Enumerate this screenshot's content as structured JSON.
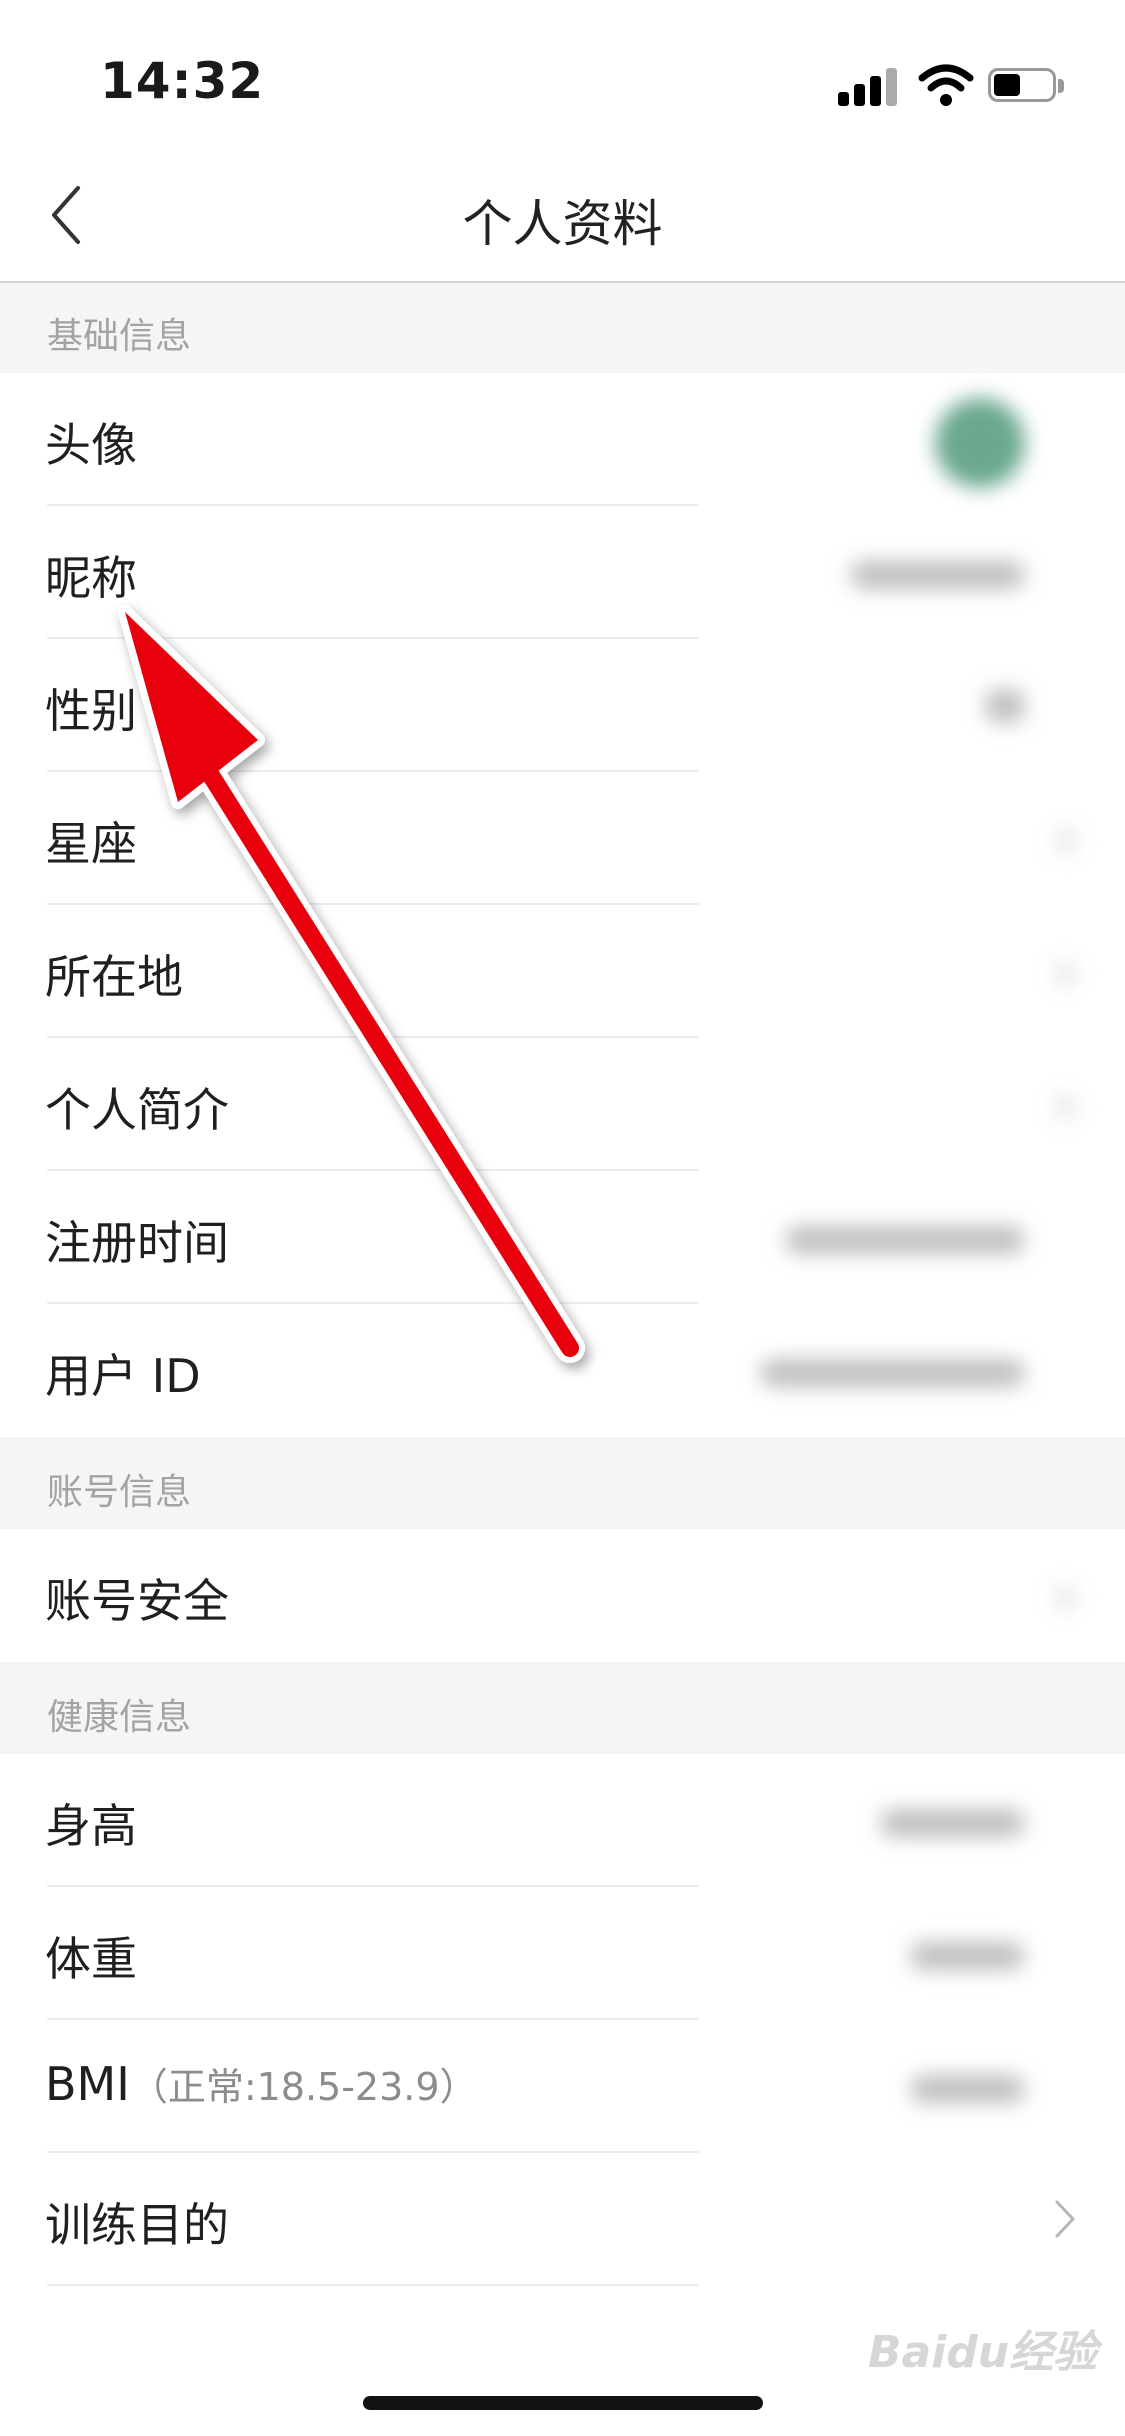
{
  "status_bar": {
    "time": "14:32"
  },
  "nav": {
    "title": "个人资料"
  },
  "sections": {
    "basic": "基础信息",
    "account": "账号信息",
    "health": "健康信息"
  },
  "rows": {
    "avatar": "头像",
    "nickname": "昵称",
    "gender": "性别",
    "constellation": "星座",
    "location": "所在地",
    "bio": "个人简介",
    "register_time": "注册时间",
    "user_id": "用户 ID",
    "account_security": "账号安全",
    "height": "身高",
    "weight": "体重",
    "bmi": "BMI",
    "bmi_hint": "（正常:18.5-23.9）",
    "training_goal": "训练目的"
  },
  "watermark": "Baidu经验",
  "icons": {
    "back": "chevron-left-icon",
    "disclosure": "chevron-right-icon",
    "annotation": "red-arrow-icon"
  },
  "colors": {
    "annotation_arrow": "#e8000b",
    "section_bg": "#f5f5f5"
  }
}
